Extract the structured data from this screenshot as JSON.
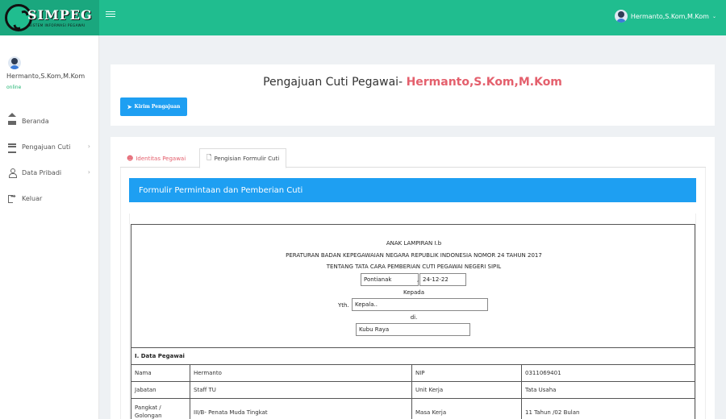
{
  "brand": {
    "title": "SIMPEG",
    "subtitle": "SISTEM INFORMASI PEGAWAI"
  },
  "topbar": {
    "user_name": "Hermanto,S.Kom,M.Kom"
  },
  "sidebar": {
    "user_name": "Hermanto,S.Kom,M.Kom",
    "status": "online",
    "items": [
      {
        "label": "Beranda",
        "icon": "home-icon"
      },
      {
        "label": "Pengajuan Cuti",
        "icon": "list-icon"
      },
      {
        "label": "Data Pribadi",
        "icon": "user-icon"
      },
      {
        "label": "Keluar",
        "icon": "logout-icon"
      }
    ]
  },
  "header": {
    "title": "Pengajuan Cuti Pegawai-",
    "name": "Hermanto,S.Kom,M.Kom",
    "button_label": "Kirim Pengajuan"
  },
  "tabs": [
    {
      "label": "Identitas Pegawai"
    },
    {
      "label": "Pengisian Formulir Cuti"
    }
  ],
  "form": {
    "header": "Formulir Permintaan dan Pemberian Cuti",
    "lampiran": "ANAK LAMPIRAN I.b",
    "peraturan": "PERATURAN BADAN KEPEGAWAIAN NEGARA REPUBLIK INDONESIA NOMOR 24 TAHUN 2017",
    "tentang": "TENTANG TATA CARA PEMBERIAN CUTI PEGAWAI NEGERI SIPIL",
    "city": "Pontianak",
    "date": "24-12-22",
    "kepada": "Kepada",
    "yth_label": "Yth.",
    "yth_value": "Kepala..",
    "di": "di.",
    "location": "Kubu Raya"
  },
  "data_pegawai": {
    "section": "I. Data Pegawai",
    "rows": [
      {
        "l1": "Nama",
        "v1": "Hermanto",
        "l2": "NIP",
        "v2": "0311069401"
      },
      {
        "l1": "Jabatan",
        "v1": "Staff TU",
        "l2": "Unit Kerja",
        "v2": "Tata Usaha"
      },
      {
        "l1": "Pangkat / Golongan",
        "v1": "III/B- Penata Muda Tingkat",
        "l2": "Masa Kerja",
        "v2": "11 Tahun /02 Bulan"
      }
    ]
  }
}
